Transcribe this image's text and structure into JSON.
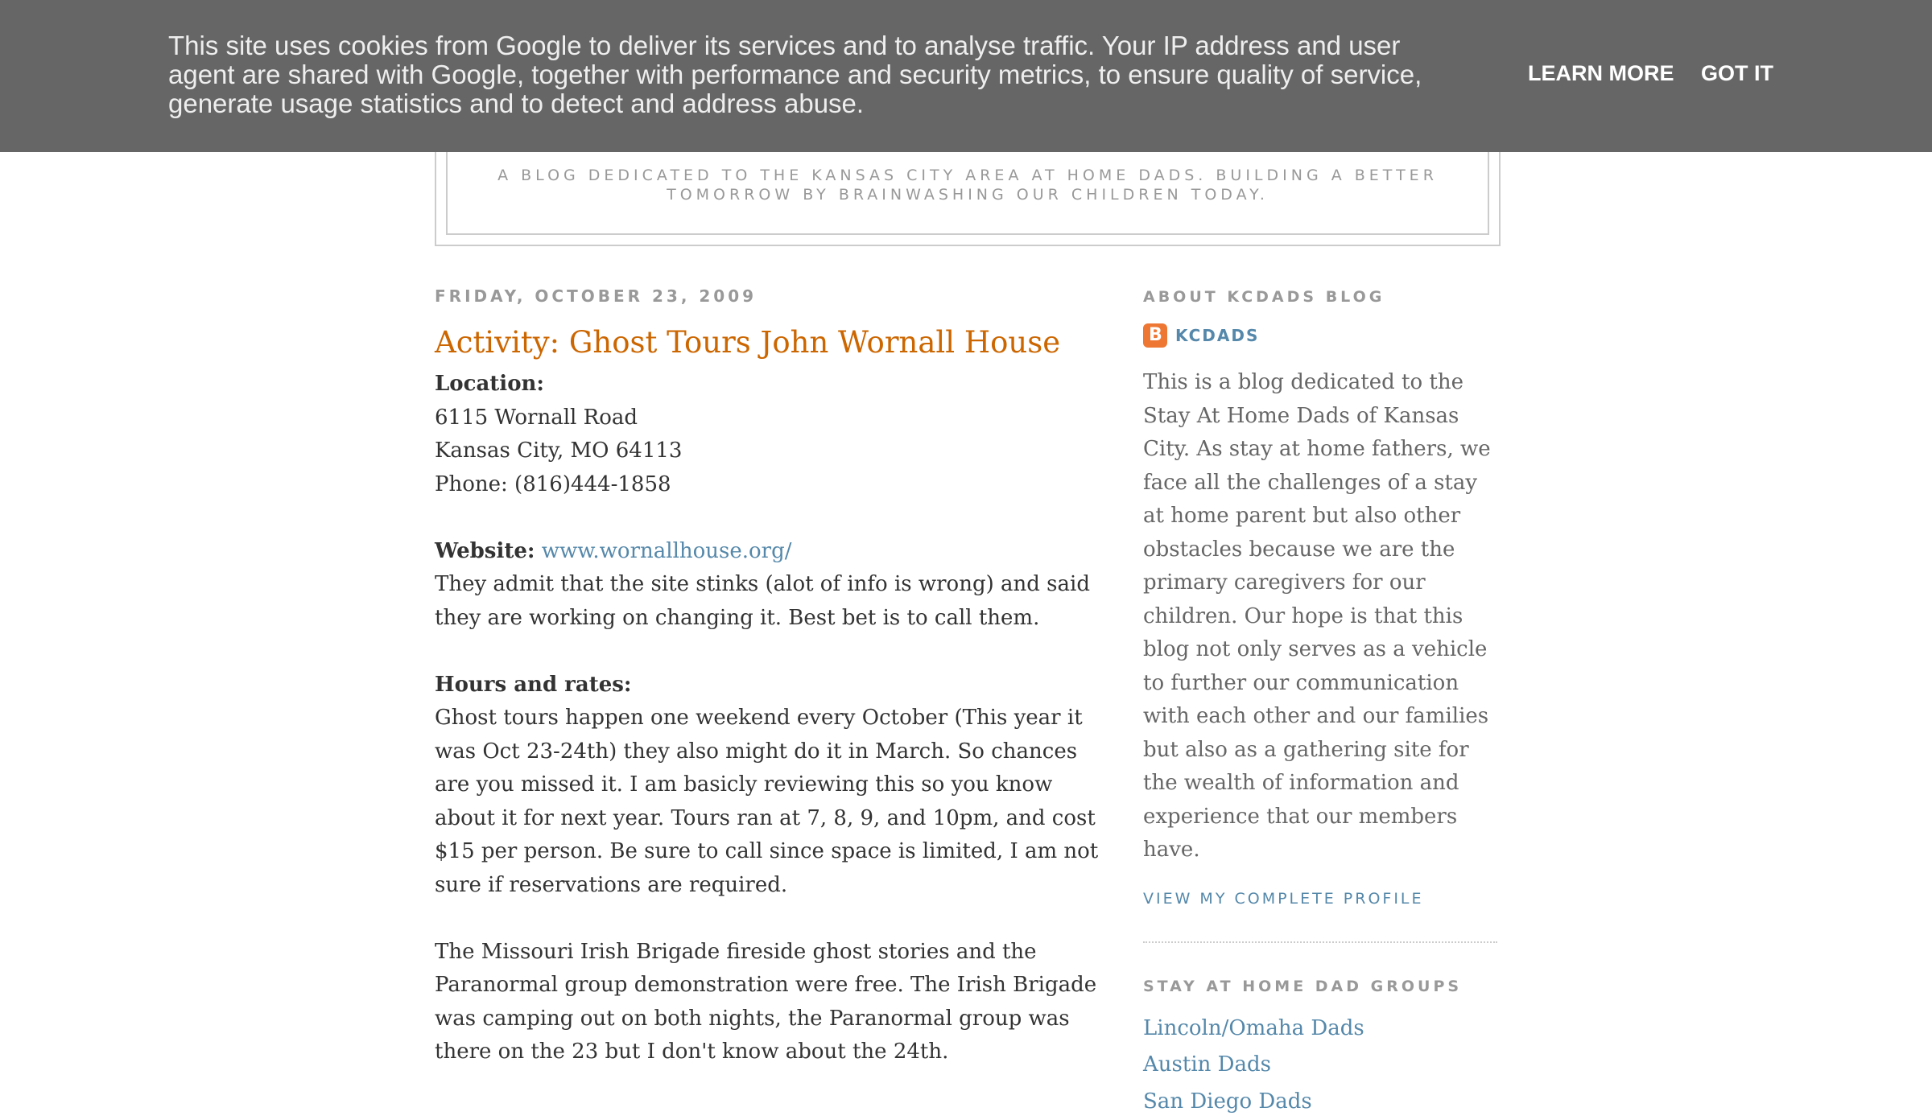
{
  "cookie_bar": {
    "text": "This site uses cookies from Google to deliver its services and to analyse traffic. Your IP address and user agent are shared with Google, together with performance and security metrics, to ensure quality of service, generate usage statistics and to detect and address abuse.",
    "learn_more_label": "LEARN MORE",
    "got_it_label": "GOT IT"
  },
  "header": {
    "tagline": "A blog dedicated to the Kansas City area at home dads. Building a better tomorrow by brainwashing our children today."
  },
  "post": {
    "date": "Friday, October 23, 2009",
    "title": "Activity: Ghost Tours John Wornall House",
    "location_label": "Location:",
    "address_line1": "6115 Wornall Road",
    "address_line2": "Kansas City, MO 64113",
    "phone": "Phone: (816)444-1858",
    "website_label": "Website:",
    "website_link": "www.wornallhouse.org/",
    "website_note": "They admit that the site stinks (alot of info is wrong) and said they are working on changing it. Best bet is to call them.",
    "hours_label": "Hours and rates:",
    "hours_text": "Ghost tours happen one weekend every October (This year it was Oct 23-24th) they also might do it in March. So chances are you missed it. I am basicly reviewing this so you know about it for next year. Tours ran at 7, 8, 9, and 10pm, and cost $15 per person. Be sure to call since space is limited, I am not sure if reservations are required.",
    "irish_text": "The Missouri Irish Brigade fireside ghost stories and the Paranormal group demonstration were free. The Irish Brigade was camping out on both nights, the Paranormal group was there on the 23 but I don't know about the 24th."
  },
  "sidebar": {
    "about_heading": "About KCDads Blog",
    "profile_name": "KCDADS",
    "about_text": "This is a blog dedicated to the Stay At Home Dads of Kansas City. As stay at home fathers, we face all the challenges of a stay at home parent but also other obstacles because we are the primary caregivers for our children. Our hope is that this blog not only serves as a vehicle to further our communication with each other and our families but also as a gathering site for the wealth of information and experience that our members have.",
    "view_profile": "View my complete profile",
    "groups_heading": "Stay At Home Dad Groups",
    "groups": [
      {
        "label": "Lincoln/Omaha Dads"
      },
      {
        "label": "Austin Dads"
      },
      {
        "label": "San Diego Dads"
      }
    ]
  },
  "colors": {
    "cookie_bg": "#666666",
    "title": "#cc6600",
    "link": "#5588aa",
    "meta": "#999999"
  }
}
